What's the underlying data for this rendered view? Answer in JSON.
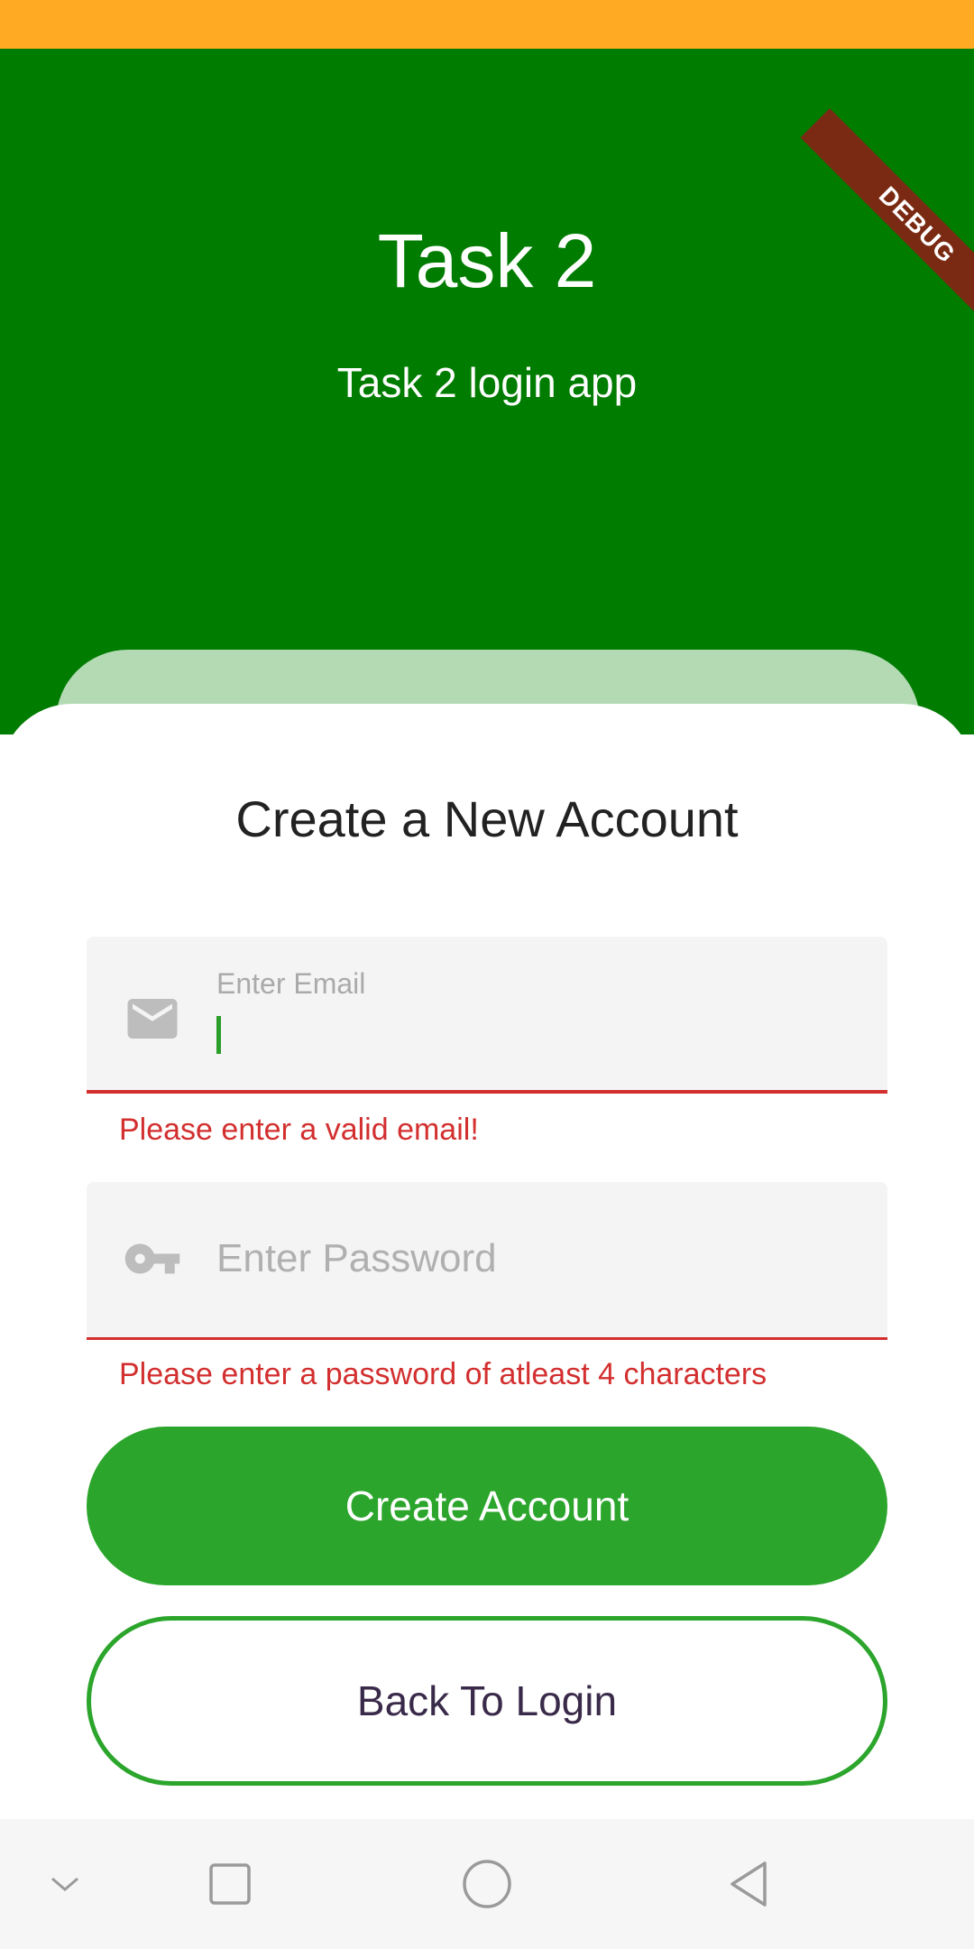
{
  "header": {
    "title": "Task 2",
    "subtitle": "Task 2 login app",
    "debug_banner": "DEBUG"
  },
  "form": {
    "title": "Create a New Account",
    "email": {
      "label": "Enter Email",
      "value": "",
      "error": "Please enter a valid email!",
      "icon": "mail-icon"
    },
    "password": {
      "placeholder": "Enter Password",
      "error": "Please enter a password of atleast 4 characters",
      "icon": "key-icon"
    },
    "create_button_label": "Create Account",
    "back_button_label": "Back To Login"
  },
  "nav": {
    "icons": [
      "chevron-down-icon",
      "recents-square-icon",
      "home-circle-icon",
      "back-triangle-icon"
    ]
  },
  "colors": {
    "status_bar": "#ffaa22",
    "header_bg": "#007c00",
    "card_back": "#b3dab3",
    "primary_button": "#2ba52b",
    "error": "#d32f2f"
  }
}
